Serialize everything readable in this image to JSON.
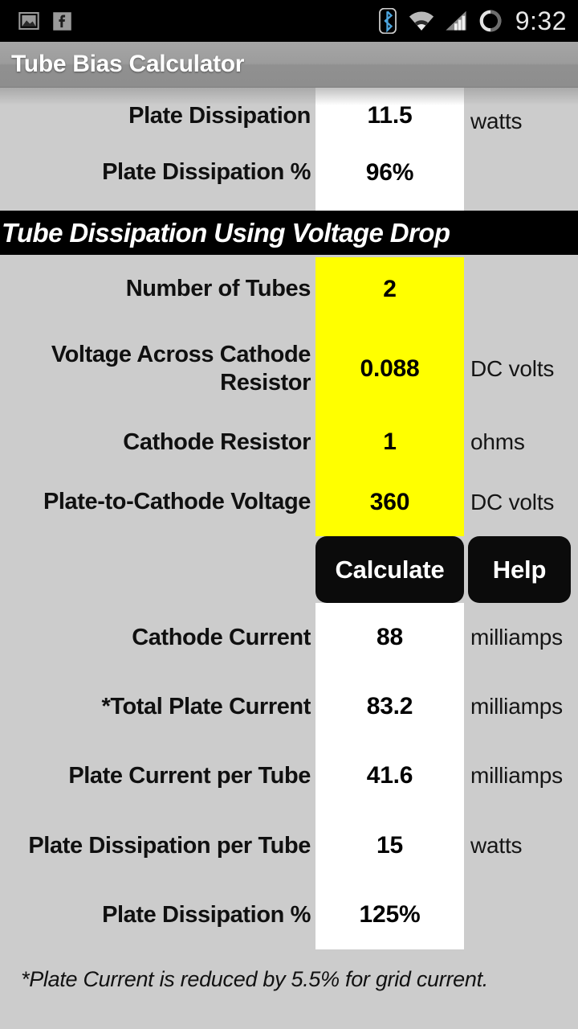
{
  "status_bar": {
    "time": "9:32",
    "left_icons": [
      "screenshot-image-icon",
      "facebook-icon"
    ],
    "right_icons": [
      "bluetooth-icon",
      "wifi-icon",
      "cellular-signal-icon",
      "battery-icon"
    ],
    "background_color": "#000000",
    "bluetooth_color": "#4da6e0"
  },
  "action_bar": {
    "title": "Tube Bias Calculator"
  },
  "top_partial_section": {
    "rows": [
      {
        "label": "Plate Dissipation",
        "value": "11.5",
        "unit": "watts"
      },
      {
        "label": "Plate Dissipation %",
        "value": "96%",
        "unit": ""
      }
    ]
  },
  "section": {
    "banner_title": "Tube Dissipation Using Voltage Drop",
    "banner_bg": "#000000",
    "banner_fg": "#ffffff"
  },
  "inputs": {
    "field_color": "#ffff00",
    "rows": [
      {
        "label": "Number of Tubes",
        "value": "2",
        "unit": ""
      },
      {
        "label": "Voltage Across Cathode Resistor",
        "value": "0.088",
        "unit": "DC volts"
      },
      {
        "label": "Cathode Resistor",
        "value": "1",
        "unit": "ohms"
      },
      {
        "label": "Plate-to-Cathode Voltage",
        "value": "360",
        "unit": "DC volts"
      }
    ]
  },
  "buttons": {
    "calculate_label": "Calculate",
    "help_label": "Help",
    "background_color": "#0b0b0b",
    "text_color": "#ffffff"
  },
  "results": {
    "field_color": "#ffffff",
    "rows": [
      {
        "label": "Cathode Current",
        "value": "88",
        "unit": "milliamps"
      },
      {
        "label": "*Total Plate Current",
        "value": "83.2",
        "unit": "milliamps"
      },
      {
        "label": "Plate Current per Tube",
        "value": "41.6",
        "unit": "milliamps"
      },
      {
        "label": "Plate Dissipation per Tube",
        "value": "15",
        "unit": "watts"
      },
      {
        "label": "Plate Dissipation %",
        "value": "125%",
        "unit": ""
      }
    ]
  },
  "footnote": {
    "text": "*Plate Current is reduced by 5.5% for grid current."
  },
  "theme": {
    "page_background": "#cccccc",
    "label_color": "#101010"
  }
}
